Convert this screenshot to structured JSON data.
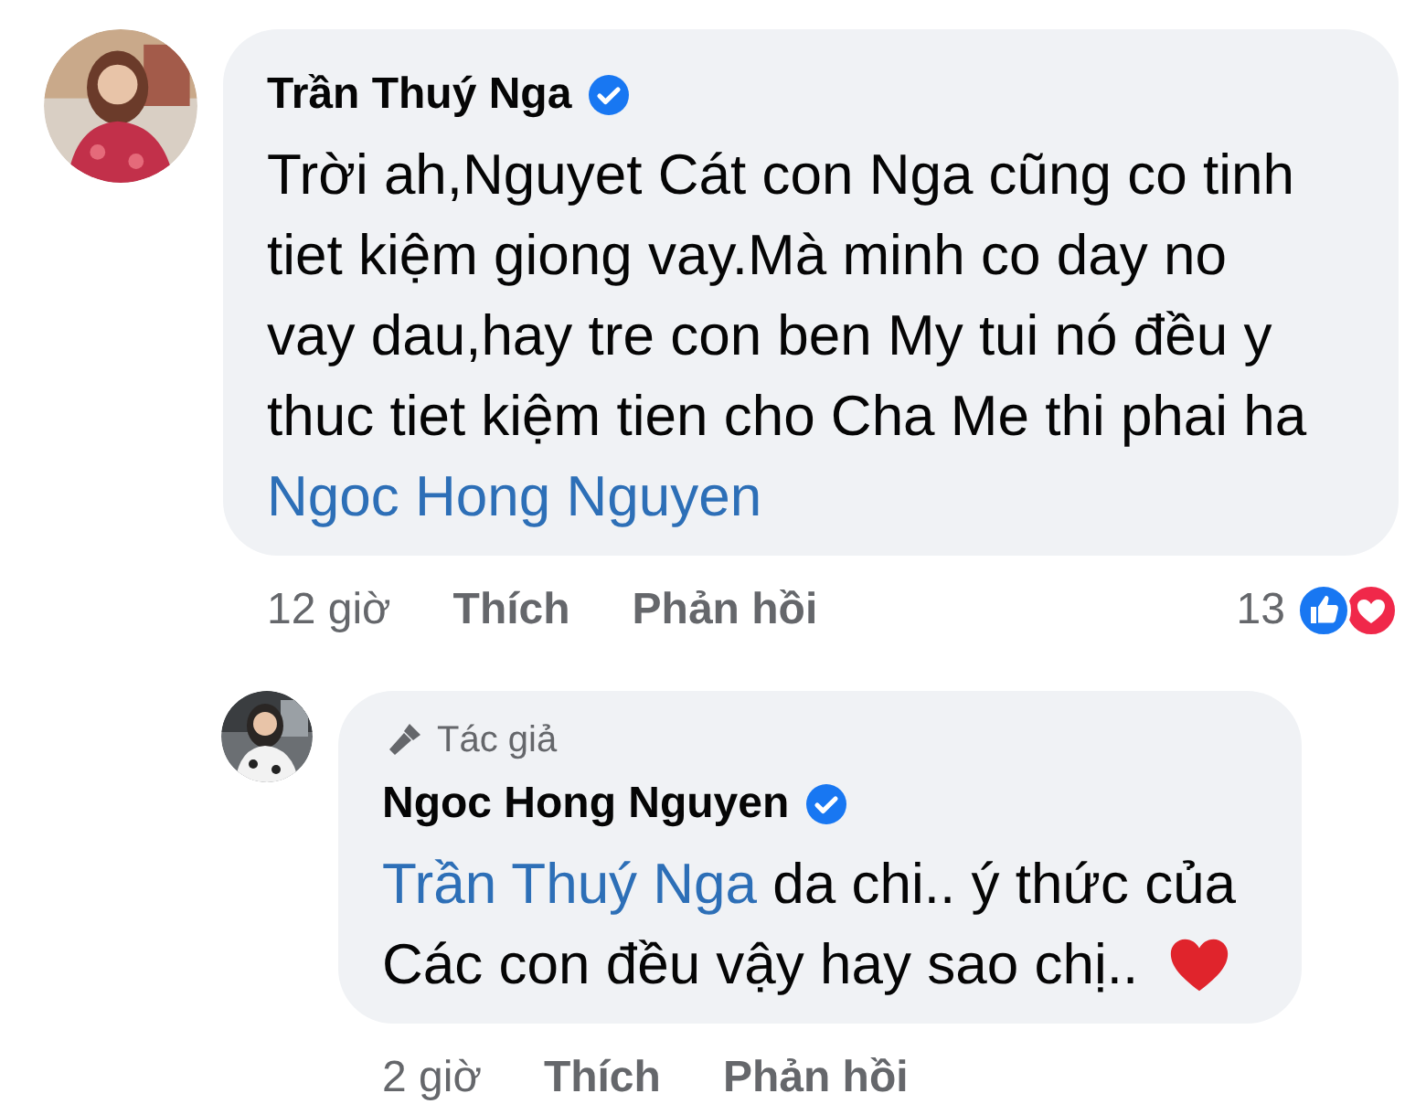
{
  "comments": [
    {
      "author": "Trần Thuý Nga",
      "verified": true,
      "body": [
        {
          "kind": "text",
          "text": "Trời ah,Nguyet Cát con Nga cũng co tinh tiet kiệm giong vay.Mà minh co day no vay dau,hay tre con ben My tui nó đều y thuc tiet kiệm tien cho Cha Me thi phai ha"
        },
        {
          "kind": "mention",
          "text": "Ngoc Hong Nguyen"
        }
      ],
      "time": "12 giờ",
      "actions": [
        "Thích",
        "Phản hồi"
      ],
      "reaction_count": "13",
      "reply": false
    },
    {
      "author": "Ngoc Hong Nguyen",
      "verified": true,
      "author_badge": "Tác giả",
      "body": [
        {
          "kind": "mention",
          "text": "Trần Thuý Nga"
        },
        {
          "kind": "text",
          "text": "da chi.. ý thức của Các con đều vậy hay sao chị.."
        },
        {
          "kind": "heart"
        }
      ],
      "time": "2 giờ",
      "actions": [
        "Thích",
        "Phản hồi"
      ],
      "reply": true
    }
  ]
}
